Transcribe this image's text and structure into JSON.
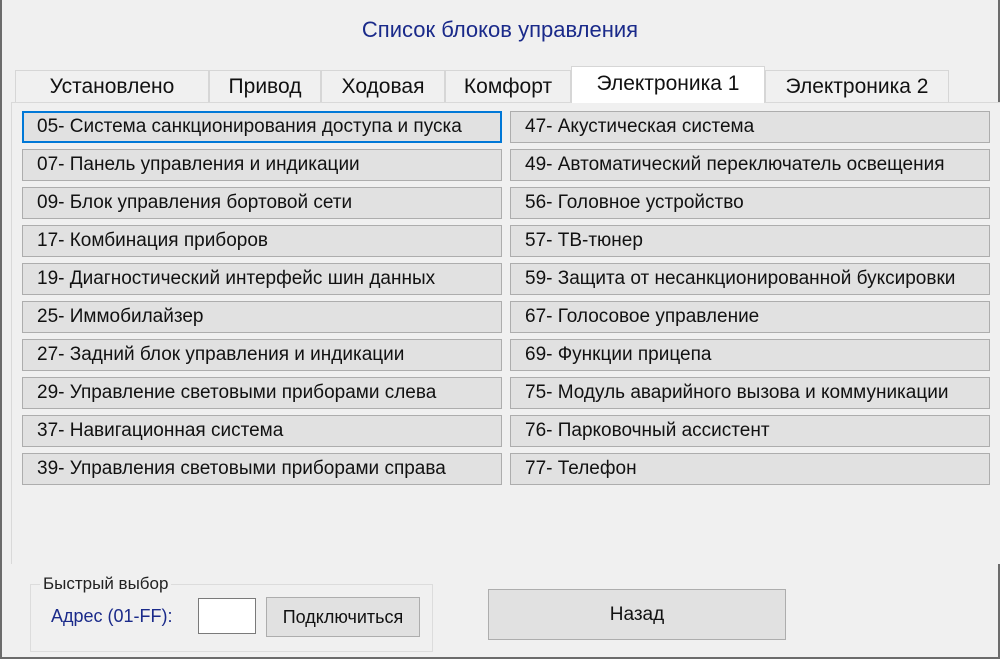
{
  "window": {
    "title": "Список блоков управления"
  },
  "tabs": [
    {
      "label": "Установлено"
    },
    {
      "label": "Привод"
    },
    {
      "label": "Ходовая"
    },
    {
      "label": "Комфорт"
    },
    {
      "label": "Электроника 1",
      "active": true
    },
    {
      "label": "Электроника 2"
    }
  ],
  "modules_left": [
    {
      "label": "05- Система санкционирования доступа и пуска",
      "focused": true
    },
    {
      "label": "07- Панель управления и индикации"
    },
    {
      "label": "09- Блок управления бортовой сети"
    },
    {
      "label": "17- Комбинация приборов"
    },
    {
      "label": "19- Диагностический интерфейс шин данных"
    },
    {
      "label": "25- Иммобилайзер"
    },
    {
      "label": "27- Задний блок управления и индикации"
    },
    {
      "label": "29- Управление световыми приборами слева"
    },
    {
      "label": "37- Навигационная система"
    },
    {
      "label": "39- Управления световыми приборами справа"
    }
  ],
  "modules_right": [
    {
      "label": "47- Акустическая система"
    },
    {
      "label": "49- Автоматический переключатель освещения"
    },
    {
      "label": "56- Головное устройство"
    },
    {
      "label": "57- ТВ-тюнер"
    },
    {
      "label": "59- Защита от несанкционированной буксировки"
    },
    {
      "label": "67- Голосовое управление"
    },
    {
      "label": "69- Функции прицепа"
    },
    {
      "label": "75- Модуль аварийного вызова и коммуникации"
    },
    {
      "label": "76- Парковочный ассистент"
    },
    {
      "label": "77- Телефон"
    }
  ],
  "quick_select": {
    "group_label": "Быстрый выбор",
    "address_label": "Адрес (01-FF):",
    "address_value": "",
    "connect_label": "Подключиться"
  },
  "back_label": "Назад",
  "colors": {
    "title": "#1a2a8a",
    "focus_border": "#0078d7",
    "button_face": "#e1e1e1"
  }
}
